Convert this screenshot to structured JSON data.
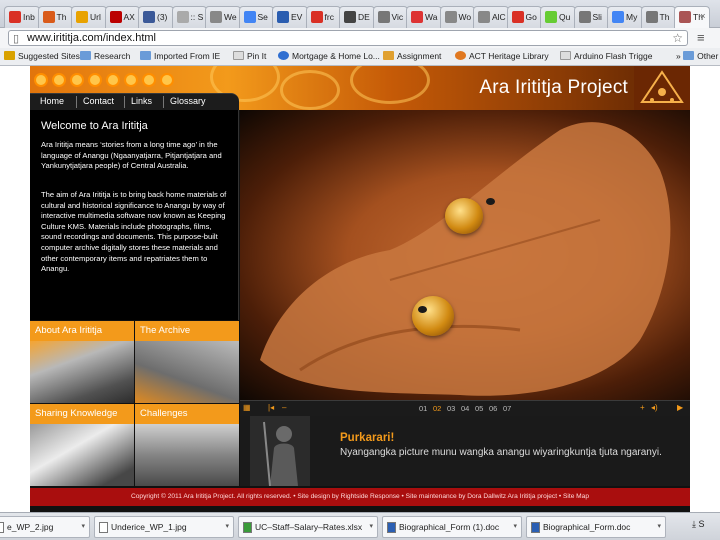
{
  "browser": {
    "tabs": [
      {
        "label": "Inb",
        "color": "#d93025"
      },
      {
        "label": "Th",
        "color": "#d95b1a"
      },
      {
        "label": "Url",
        "color": "#e8a200"
      },
      {
        "label": "AX",
        "color": "#b00"
      },
      {
        "label": "(3)",
        "color": "#3b5998"
      },
      {
        "label": ":: S",
        "color": "#aaa"
      },
      {
        "label": "We",
        "color": "#888"
      },
      {
        "label": "Se",
        "color": "#4285f4"
      },
      {
        "label": "EV",
        "color": "#2a5db0"
      },
      {
        "label": "frc",
        "color": "#d93025"
      },
      {
        "label": "DE",
        "color": "#444"
      },
      {
        "label": "Vic",
        "color": "#777"
      },
      {
        "label": "Wa",
        "color": "#d33"
      },
      {
        "label": "Wo",
        "color": "#888"
      },
      {
        "label": "AlC",
        "color": "#888"
      },
      {
        "label": "Go",
        "color": "#d93025"
      },
      {
        "label": "Qu",
        "color": "#6c3"
      },
      {
        "label": "Sli",
        "color": "#777"
      },
      {
        "label": "My",
        "color": "#4285f4"
      },
      {
        "label": "Th",
        "color": "#777"
      },
      {
        "label": "Th",
        "color": "#a55"
      }
    ],
    "url": "www.irititja.com/index.html",
    "bookmarks": [
      "Suggested Sites",
      "Research",
      "Imported From IE",
      "Pin It",
      "Mortgage & Home Lo...",
      "Assignment",
      "ACT Heritage Library",
      "Arduino Flash Trigge",
      "Other"
    ]
  },
  "site": {
    "title": "Ara Irititja Project",
    "nav": [
      "Home",
      "Contact",
      "Links",
      "Glossary"
    ],
    "welcome": {
      "heading": "Welcome to Ara Irititja",
      "p1": "Ara Irititja means ‘stories from a long time ago’ in the language of Anangu (Ngaanyatjarra, Pitjantjatjara and Yankunytjatjara people) of Central Australia.",
      "p2": "The aim of Ara Irititja is to bring back home materials of cultural and historical significance to Anangu by way of interactive multimedia software now known as Keeping Culture KMS. Materials include photographs, films, sound recordings and documents. This purpose-built computer archive digitally stores these materials and other contemporary items and repatriates them to Anangu."
    },
    "tiles": [
      {
        "label": "About Ara Irititja"
      },
      {
        "label": "The Archive"
      },
      {
        "label": "Sharing Knowledge"
      },
      {
        "label": "Challenges"
      }
    ],
    "slides": [
      "01",
      "02",
      "03",
      "04",
      "05",
      "06",
      "07"
    ],
    "active_slide": "02",
    "caption": {
      "title": "Purkarari!",
      "text": "Nyangangka picture munu wangka anangu wiyaringkuntja tjuta ngaranyi."
    },
    "footer": "Copyright © 2011 Ara Irititja Project. All rights reserved. • Site design by Rightside Response • Site maintenance by Dora Dallwitz Ara Irititja project • Site Map"
  },
  "downloads": {
    "items": [
      "e_WP_2.jpg",
      "Underice_WP_1.jpg",
      "UC–Staff–Salary–Rates.xlsx",
      "Biographical_Form (1).doc",
      "Biographical_Form.doc"
    ],
    "show_all": "S"
  },
  "colors": {
    "accent": "#f39a1b",
    "footer": "#a90e0e"
  }
}
